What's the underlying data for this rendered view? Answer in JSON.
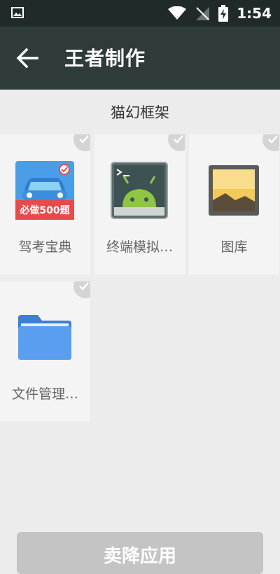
{
  "status_bar": {
    "time": "1:54"
  },
  "app_bar": {
    "title": "王者制作"
  },
  "section": {
    "title": "猫幻框架"
  },
  "apps": [
    {
      "label": "驾考宝典",
      "icon": "driving-test-icon",
      "badge_text": "必做500题"
    },
    {
      "label": "终端模拟…",
      "icon": "android-terminal-icon"
    },
    {
      "label": "图库",
      "icon": "gallery-icon"
    },
    {
      "label": "文件管理…",
      "icon": "folder-icon"
    }
  ],
  "bottom_button": {
    "label": "卖降应用"
  },
  "colors": {
    "status_bar": "#1f2a29",
    "app_bar": "#2f3b3a",
    "background": "#ececec",
    "tile": "#f4f4f4",
    "button_disabled": "#c4c4c4"
  }
}
